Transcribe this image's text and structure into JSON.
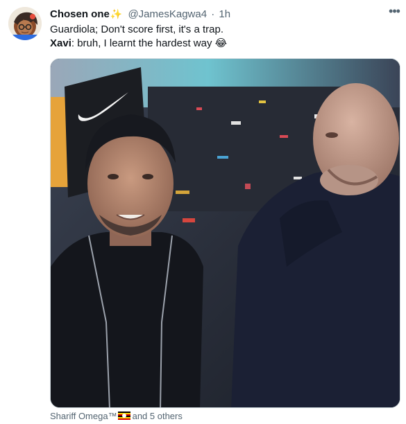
{
  "author": {
    "display_name": "Chosen one",
    "badge_emoji": "✨",
    "handle": "@JamesKagwa4",
    "separator": "·",
    "time": "1h"
  },
  "more_label": "•••",
  "tweet": {
    "line1": "Guardiola; Don't score first, it's a trap.",
    "line2_speaker": "Xavi",
    "line2_text": ": bruh, I learnt the hardest way ",
    "line2_emoji": "😂"
  },
  "media": {
    "brand_icon": "swoosh-logo"
  },
  "footer": {
    "tagged_name": "Shariff Omega™",
    "flag_icon": "uganda-flag-icon",
    "others_text": "and 5 others"
  },
  "colors": {
    "text": "#0f1419",
    "secondary": "#536471",
    "border": "#cfd9de"
  }
}
